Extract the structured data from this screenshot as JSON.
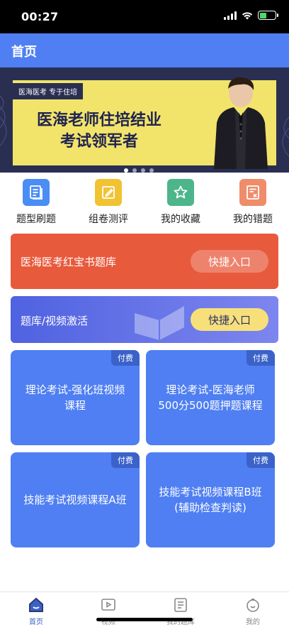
{
  "status": {
    "time": "00:27"
  },
  "nav": {
    "title": "首页"
  },
  "banner": {
    "tag": "医海医考 专于住培",
    "headline_line1": "医海老师住培结业",
    "headline_line2": "考试领军者",
    "dot_count": 4,
    "active_dot": 1
  },
  "quick": [
    {
      "label": "题型刷题",
      "icon": "list-icon",
      "color": "#4a8df5"
    },
    {
      "label": "组卷测评",
      "icon": "edit-icon",
      "color": "#f1c232"
    },
    {
      "label": "我的收藏",
      "icon": "star-icon",
      "color": "#4cb58a"
    },
    {
      "label": "我的错题",
      "icon": "wrong-icon",
      "color": "#ef8c6a"
    }
  ],
  "entries": {
    "red": {
      "title": "医海医考红宝书题库",
      "button": "快捷入口",
      "color": "#e85a3c"
    },
    "blue": {
      "title": "题库/视频激活",
      "button": "快捷入口"
    }
  },
  "courses": [
    {
      "badge": "付费",
      "title_line1": "理论考试-强化班视频",
      "title_line2": "课程"
    },
    {
      "badge": "付费",
      "title_line1": "理论考试-医海老师",
      "title_line2": "500分500题押题课程"
    },
    {
      "badge": "付费",
      "title_line1": "技能考试视频课程A班",
      "title_line2": ""
    },
    {
      "badge": "付费",
      "title_line1": "技能考试视频课程B班",
      "title_line2": "(辅助检查判读)"
    }
  ],
  "tabs": [
    {
      "label": "首页",
      "icon": "home-icon"
    },
    {
      "label": "视频",
      "icon": "video-icon"
    },
    {
      "label": "我的题库",
      "icon": "question-bank-icon"
    },
    {
      "label": "我的",
      "icon": "profile-icon"
    }
  ],
  "colors": {
    "accent": "#4f7ff2",
    "course_card": "#4f7ff2",
    "badge": "#3a62c9"
  }
}
